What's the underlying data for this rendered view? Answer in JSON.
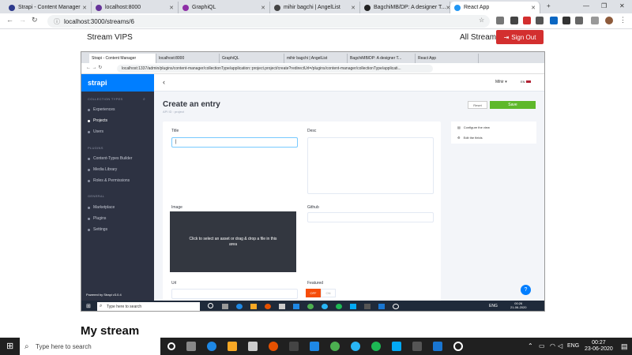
{
  "browser": {
    "tabs": [
      {
        "title": "Strapi - Content Manager",
        "color": "#2e3a8c"
      },
      {
        "title": "localhost:8000",
        "color": "#663399"
      },
      {
        "title": "GraphiQL",
        "color": "#8e2ea6"
      },
      {
        "title": "mihir bagchi | AngelList",
        "color": "#444444"
      },
      {
        "title": "BagchiMB/DP: A designer T...",
        "color": "#222222"
      },
      {
        "title": "React App",
        "color": "#2196f3"
      }
    ],
    "url": "localhost:3000/streams/6"
  },
  "app": {
    "brand": "Stream VIPS",
    "all_streams": "All Streams",
    "sign_out": "Sign Out",
    "heading": "My stream"
  },
  "inner_browser": {
    "tabs": [
      {
        "title": "Strapi - Content Manager"
      },
      {
        "title": "localhost:8000"
      },
      {
        "title": "GraphiQL"
      },
      {
        "title": "mihir bagchi | AngelList"
      },
      {
        "title": "BagchiMB/DP: A designer T..."
      },
      {
        "title": "React App"
      }
    ],
    "url": "localhost:1337/admin/plugins/content-manager/collectionType/application::project.project/create?redirectUrl=/plugins/content-manager/collectionType/applicati..."
  },
  "strapi": {
    "logo": "strapi",
    "sections": {
      "collection_types": "COLLECTION TYPES",
      "plugins": "PLUGINS",
      "general": "GENERAL"
    },
    "collection_items": [
      "Experiences",
      "Projects",
      "Users"
    ],
    "plugin_items": [
      "Content-Types Builder",
      "Media Library",
      "Roles & Permissions"
    ],
    "general_items": [
      "Marketplace",
      "Plugins",
      "Settings"
    ],
    "powered": "Powered by Strapi v3.0.4",
    "user": "Mihir",
    "lang": "EN",
    "title": "Create an entry",
    "api_id": "API ID : project",
    "reset": "Reset",
    "save": "Save",
    "fields": {
      "title": "Title",
      "desc": "Desc",
      "image": "Image",
      "github": "Github",
      "url": "Url",
      "featured": "Featured"
    },
    "image_drop": "Click to select an asset or drag & drop a file in this area",
    "toggle_off": "OFF",
    "toggle_on": "ON",
    "configure_view": "Configure the view",
    "edit_fields": "Edit the fields",
    "help": "?"
  },
  "inner_taskbar": {
    "search": "Type here to search",
    "lang": "ENG",
    "time": "00:26",
    "date": "21-06-2020"
  },
  "taskbar": {
    "search": "Type here to search",
    "lang": "ENG",
    "time": "00:27",
    "date": "23-06-2020"
  }
}
